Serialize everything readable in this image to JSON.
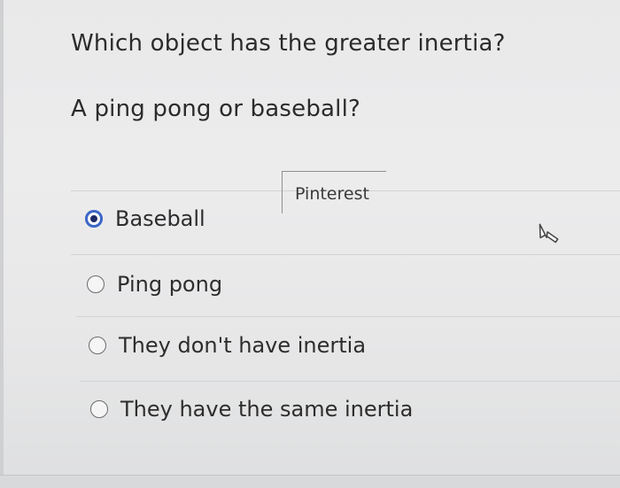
{
  "question": {
    "line1": "Which object has the greater inertia?",
    "line2": "A ping pong or baseball?"
  },
  "tooltip": {
    "label": "Pinterest"
  },
  "options": [
    {
      "label": "Baseball",
      "selected": true
    },
    {
      "label": "Ping pong",
      "selected": false
    },
    {
      "label": "They don't have inertia",
      "selected": false
    },
    {
      "label": "They have the same inertia",
      "selected": false
    }
  ],
  "colors": {
    "background": "#e9e9ea",
    "text": "#2b2b2b",
    "radio_selected": "#3b66c8",
    "radio_selected_dark": "#1f2a66",
    "divider": "#d3d4d6"
  },
  "icons": {
    "cursor": "hand-pointer-icon"
  }
}
